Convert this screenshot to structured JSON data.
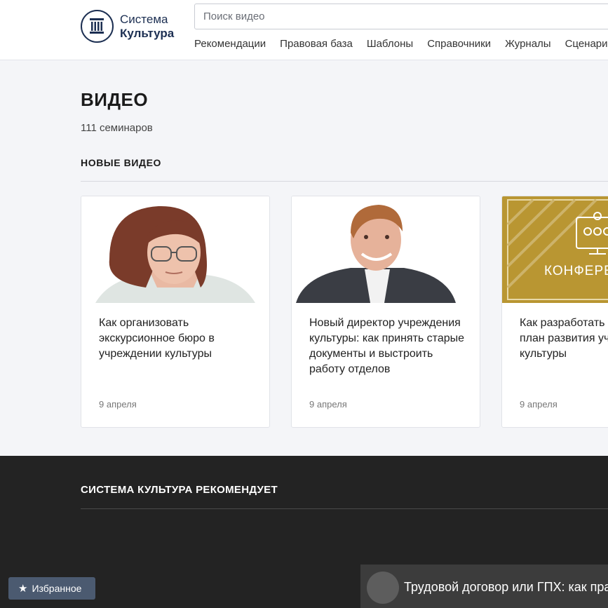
{
  "header": {
    "logo": {
      "line1": "Система",
      "line2": "Культура"
    },
    "search": {
      "placeholder": "Поиск видео"
    },
    "nav": [
      {
        "label": "Рекомендации"
      },
      {
        "label": "Правовая база"
      },
      {
        "label": "Шаблоны"
      },
      {
        "label": "Справочники"
      },
      {
        "label": "Журналы"
      },
      {
        "label": "Сценарии"
      }
    ]
  },
  "main": {
    "title": "ВИДЕО",
    "subtitle": "111 семинаров",
    "section_title": "НОВЫЕ ВИДЕО",
    "cards": [
      {
        "title": "Как организовать экскурсионное бюро в учреждении культуры",
        "date": "9 апреля"
      },
      {
        "title": "Новый директор учреждения культуры: как принять старые документы и выстроить работу отделов",
        "date": "9 апреля"
      },
      {
        "title": "Как разработать стратегию и план развития учреждения культуры",
        "date": "9 апреля",
        "thumb_label": "КОНФЕРЕНЦИЯ"
      }
    ]
  },
  "recommend": {
    "title": "СИСТЕМА КУЛЬТУРА РЕКОМЕНДУЕТ",
    "video_title": "Трудовой договор или ГПХ: как правильно оформить"
  },
  "favorites": {
    "label": "Избранное",
    "icon": "star-icon"
  },
  "colors": {
    "accent": "#1c2f52",
    "dark_bg": "#232323",
    "conference": "#b99632",
    "fav_button": "#4b5a70"
  }
}
